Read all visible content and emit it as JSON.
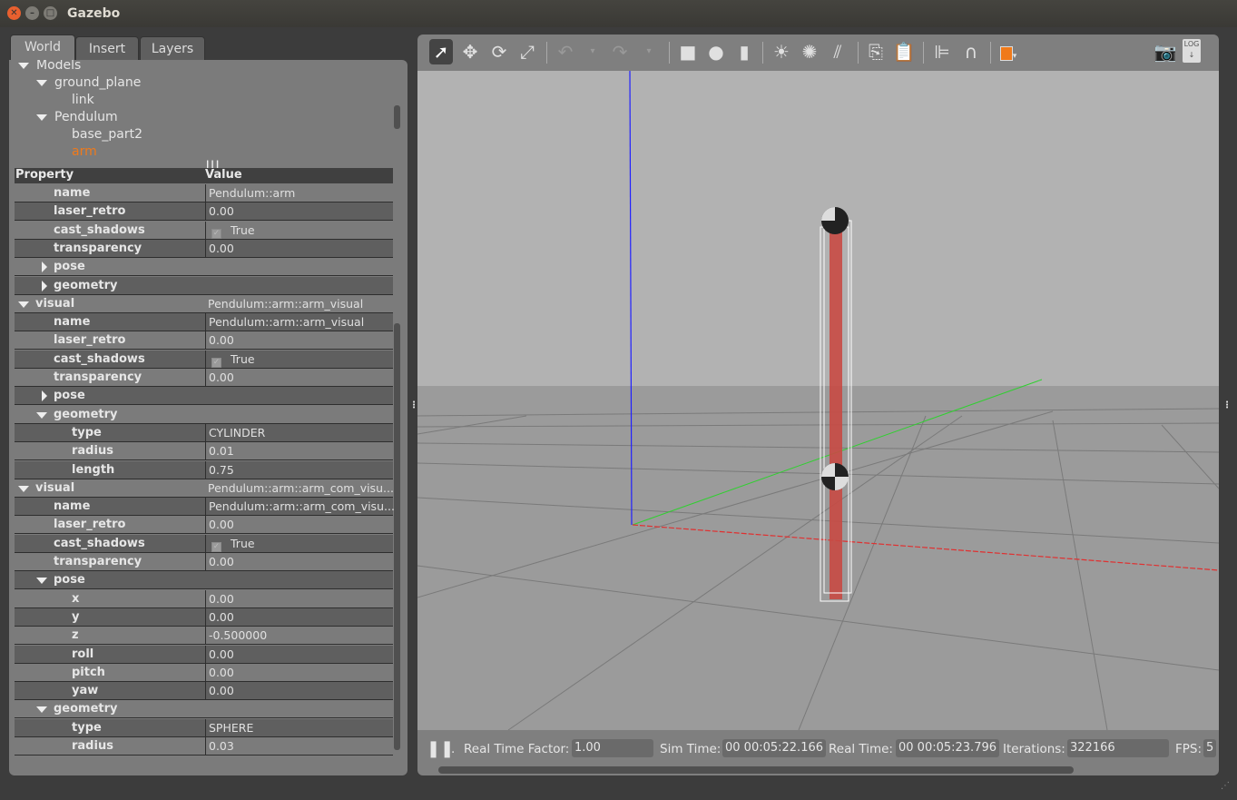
{
  "window": {
    "title": "Gazebo"
  },
  "tabs": [
    "World",
    "Insert",
    "Layers"
  ],
  "tree": {
    "root": "Models",
    "items": [
      {
        "label": "ground_plane",
        "level": 1,
        "expanded": true
      },
      {
        "label": "link",
        "level": 2
      },
      {
        "label": "Pendulum",
        "level": 1,
        "expanded": true
      },
      {
        "label": "base_part2",
        "level": 2
      },
      {
        "label": "arm",
        "level": 2,
        "selected": true
      }
    ]
  },
  "properties": {
    "header": {
      "property": "Property",
      "value": "Value"
    },
    "rows": [
      {
        "key": "name",
        "value": "Pendulum::arm",
        "indent": 1
      },
      {
        "key": "laser_retro",
        "value": "0.00",
        "indent": 1
      },
      {
        "key": "cast_shadows",
        "value": "True",
        "indent": 1,
        "checkbox": true
      },
      {
        "key": "transparency",
        "value": "0.00",
        "indent": 1
      },
      {
        "key": "pose",
        "indent": 1,
        "expander": "collapsed"
      },
      {
        "key": "geometry",
        "indent": 1,
        "expander": "collapsed"
      },
      {
        "key": "visual",
        "value": "Pendulum::arm::arm_visual",
        "indent": 0,
        "expander": "expanded"
      },
      {
        "key": "name",
        "value": "Pendulum::arm::arm_visual",
        "indent": 1
      },
      {
        "key": "laser_retro",
        "value": "0.00",
        "indent": 1
      },
      {
        "key": "cast_shadows",
        "value": "True",
        "indent": 1,
        "checkbox": true
      },
      {
        "key": "transparency",
        "value": "0.00",
        "indent": 1
      },
      {
        "key": "pose",
        "indent": 1,
        "expander": "collapsed"
      },
      {
        "key": "geometry",
        "indent": 1,
        "expander": "expanded"
      },
      {
        "key": "type",
        "value": "CYLINDER",
        "indent": 2
      },
      {
        "key": "radius",
        "value": "0.01",
        "indent": 2
      },
      {
        "key": "length",
        "value": "0.75",
        "indent": 2
      },
      {
        "key": "visual",
        "value": "Pendulum::arm::arm_com_visu...",
        "indent": 0,
        "expander": "expanded"
      },
      {
        "key": "name",
        "value": "Pendulum::arm::arm_com_visu...",
        "indent": 1
      },
      {
        "key": "laser_retro",
        "value": "0.00",
        "indent": 1
      },
      {
        "key": "cast_shadows",
        "value": "True",
        "indent": 1,
        "checkbox": true
      },
      {
        "key": "transparency",
        "value": "0.00",
        "indent": 1
      },
      {
        "key": "pose",
        "indent": 1,
        "expander": "expanded"
      },
      {
        "key": "x",
        "value": "0.00",
        "indent": 2
      },
      {
        "key": "y",
        "value": "0.00",
        "indent": 2
      },
      {
        "key": "z",
        "value": "-0.500000",
        "indent": 2
      },
      {
        "key": "roll",
        "value": "0.00",
        "indent": 2
      },
      {
        "key": "pitch",
        "value": "0.00",
        "indent": 2
      },
      {
        "key": "yaw",
        "value": "0.00",
        "indent": 2
      },
      {
        "key": "geometry",
        "indent": 1,
        "expander": "expanded"
      },
      {
        "key": "type",
        "value": "SPHERE",
        "indent": 2
      },
      {
        "key": "radius",
        "value": "0.03",
        "indent": 2
      }
    ]
  },
  "toolbar": {
    "icons": [
      "select-arrow",
      "translate",
      "rotate",
      "scale",
      "undo",
      "undo-menu",
      "redo",
      "redo-menu",
      "box",
      "sphere",
      "cylinder",
      "point-light",
      "spot-light",
      "directional-light",
      "copy",
      "paste",
      "align",
      "magnet",
      "view-angle",
      "screenshot",
      "log"
    ]
  },
  "status": {
    "real_time_factor_label": "Real Time Factor:",
    "real_time_factor": "1.00",
    "sim_time_label": "Sim Time:",
    "sim_time": "00 00:05:22.166",
    "real_time_label": "Real Time:",
    "real_time": "00 00:05:23.796",
    "iterations_label": "Iterations:",
    "iterations": "322166",
    "fps_label": "FPS:",
    "fps": "5",
    "step_label": "."
  },
  "colors": {
    "selected": "#f07a1a",
    "x_axis": "#e03030",
    "y_axis": "#30d030",
    "z_axis": "#2020ff",
    "arm": "#c84a44"
  },
  "toolbar_log_label": "LOG"
}
